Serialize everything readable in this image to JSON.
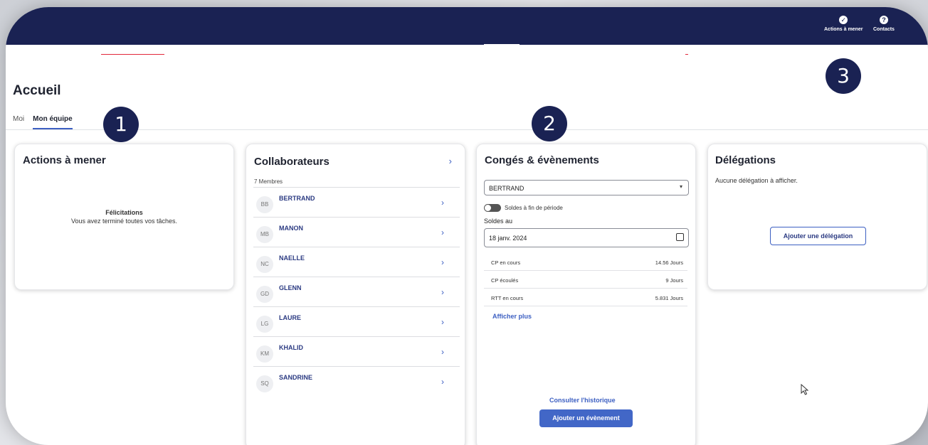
{
  "topbar": {
    "actions_label": "Actions à mener",
    "contacts_label": "Contacts",
    "actions_icon": "check-circle-icon",
    "contacts_icon": "help-circle-icon"
  },
  "page": {
    "title": "Accueil",
    "tabs": [
      {
        "label": "Moi",
        "active": false
      },
      {
        "label": "Mon équipe",
        "active": true
      }
    ]
  },
  "markers": [
    "1",
    "2",
    "3"
  ],
  "actions_card": {
    "title": "Actions à mener",
    "congrats_title": "Félicitations",
    "congrats_text": "Vous avez terminé toutes vos tâches."
  },
  "collaborators_card": {
    "title": "Collaborateurs",
    "count": "7 Membres",
    "members": [
      {
        "initials": "BB",
        "name": "BERTRAND"
      },
      {
        "initials": "MB",
        "name": "MANON"
      },
      {
        "initials": "NC",
        "name": "NAELLE"
      },
      {
        "initials": "GD",
        "name": "GLENN"
      },
      {
        "initials": "LG",
        "name": "LAURE"
      },
      {
        "initials": "KM",
        "name": "KHALID"
      },
      {
        "initials": "SQ",
        "name": "SANDRINE"
      }
    ]
  },
  "leave_card": {
    "title": "Congés & évènements",
    "selected_person": "BERTRAND",
    "toggle_label": "Soldes à fin de période",
    "balance_date_label": "Soldes au",
    "balance_date": "18 janv. 2024",
    "balances": [
      {
        "label": "CP en cours",
        "value": "14.56 Jours"
      },
      {
        "label": "CP écoulés",
        "value": "9 Jours"
      },
      {
        "label": "RTT en cours",
        "value": "5.831 Jours"
      }
    ],
    "show_more": "Afficher plus",
    "history_link": "Consulter l'historique",
    "add_event_button": "Ajouter un évènement"
  },
  "delegations_card": {
    "title": "Délégations",
    "empty_text": "Aucune délégation à afficher.",
    "add_button": "Ajouter une délégation"
  },
  "colors": {
    "navy": "#1a2253",
    "accent": "#3c5fc2",
    "primary_button": "#4267c7"
  }
}
